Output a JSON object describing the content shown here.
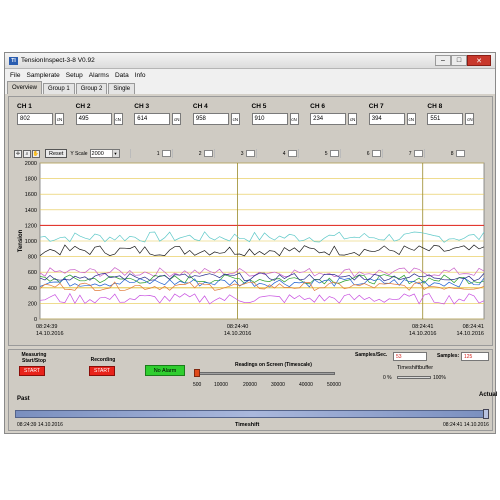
{
  "window": {
    "title": "TensionInspect-3-8  V0.92",
    "app_icon": "TI",
    "minimize": "–",
    "maximize": "□",
    "close": "✕"
  },
  "menu": [
    "File",
    "Samplerate",
    "Setup",
    "Alarms",
    "Data",
    "Info"
  ],
  "tabs": [
    "Overview",
    "Group 1",
    "Group 2",
    "Single"
  ],
  "channels": [
    {
      "label": "CH 1",
      "value": "802",
      "unit": "cN"
    },
    {
      "label": "CH 2",
      "value": "495",
      "unit": "cN"
    },
    {
      "label": "CH 3",
      "value": "614",
      "unit": "cN"
    },
    {
      "label": "CH 4",
      "value": "958",
      "unit": "cN"
    },
    {
      "label": "CH 5",
      "value": "910",
      "unit": "cN"
    },
    {
      "label": "CH 6",
      "value": "234",
      "unit": "cN"
    },
    {
      "label": "CH 7",
      "value": "394",
      "unit": "cN"
    },
    {
      "label": "CH 8",
      "value": "551",
      "unit": "cN"
    }
  ],
  "toolbar": {
    "reset": "Reset",
    "yscale_label": "Y Scale",
    "yscale_value": "2000",
    "series_numbers": [
      "1",
      "2",
      "3",
      "4",
      "5",
      "6",
      "7",
      "8"
    ]
  },
  "chart_data": {
    "type": "line",
    "ylabel": "Tension",
    "ylim": [
      0,
      2000
    ],
    "yticks": [
      "2000",
      "1800",
      "1600",
      "1400",
      "1200",
      "1000",
      "800",
      "600",
      "400",
      "200",
      "0"
    ],
    "xticks": [
      {
        "time": "08:24:39",
        "date": "14.10.2016"
      },
      {
        "time": "08:24:40",
        "date": "14.10.2016"
      },
      {
        "time": "08:24:41",
        "date": "14.10.2016"
      },
      {
        "time": "08:24:41",
        "date": "14.10.2016"
      }
    ],
    "upper_alarm": 1200,
    "lower_alarm": 400,
    "colors": {
      "grid": "#e6c74c",
      "upper_alarm": "#e02020",
      "lower_alarm": "#e6c74c",
      "background": "#ffffff",
      "cursor": "#9a8a2a"
    },
    "series": [
      {
        "color": "#5dc8c8",
        "level": 1050,
        "spread": 70
      },
      {
        "color": "#1a1a1a",
        "level": 880,
        "spread": 70
      },
      {
        "color": "#c860c8",
        "level": 600,
        "spread": 60
      },
      {
        "color": "#2aa02a",
        "level": 510,
        "spread": 60
      },
      {
        "color": "#2060d0",
        "level": 470,
        "spread": 60
      },
      {
        "color": "#e07a3a",
        "level": 420,
        "spread": 55
      },
      {
        "color": "#2a2a8a",
        "level": 540,
        "spread": 50
      },
      {
        "color": "#c850e0",
        "level": 260,
        "spread": 70
      }
    ]
  },
  "bottom": {
    "measuring_label": "Measuring Start/Stop",
    "measuring_btn": "START",
    "recording_label": "Recording",
    "recording_btn": "START",
    "alarm_btn": "No Alarm",
    "readings_label": "Readings on Screen (Timescale)",
    "readings_ticks": [
      "500",
      "10000",
      "20000",
      "30000",
      "40000",
      "50000"
    ],
    "samples_sec_label": "Samples/Sec.",
    "samples_sec_value": "53",
    "samples_label": "Samples:",
    "samples_value": "125",
    "timeshift_buffer_label": "Timeshiftbuffer",
    "buffer_min": "0 %",
    "buffer_max": "100%",
    "past_label": "Past",
    "actual_label": "Actual",
    "timeshift_label": "Timeshift",
    "start_time": "08:24:39 14.10.2016",
    "end_time": "08:24:41 14.10.2016"
  }
}
